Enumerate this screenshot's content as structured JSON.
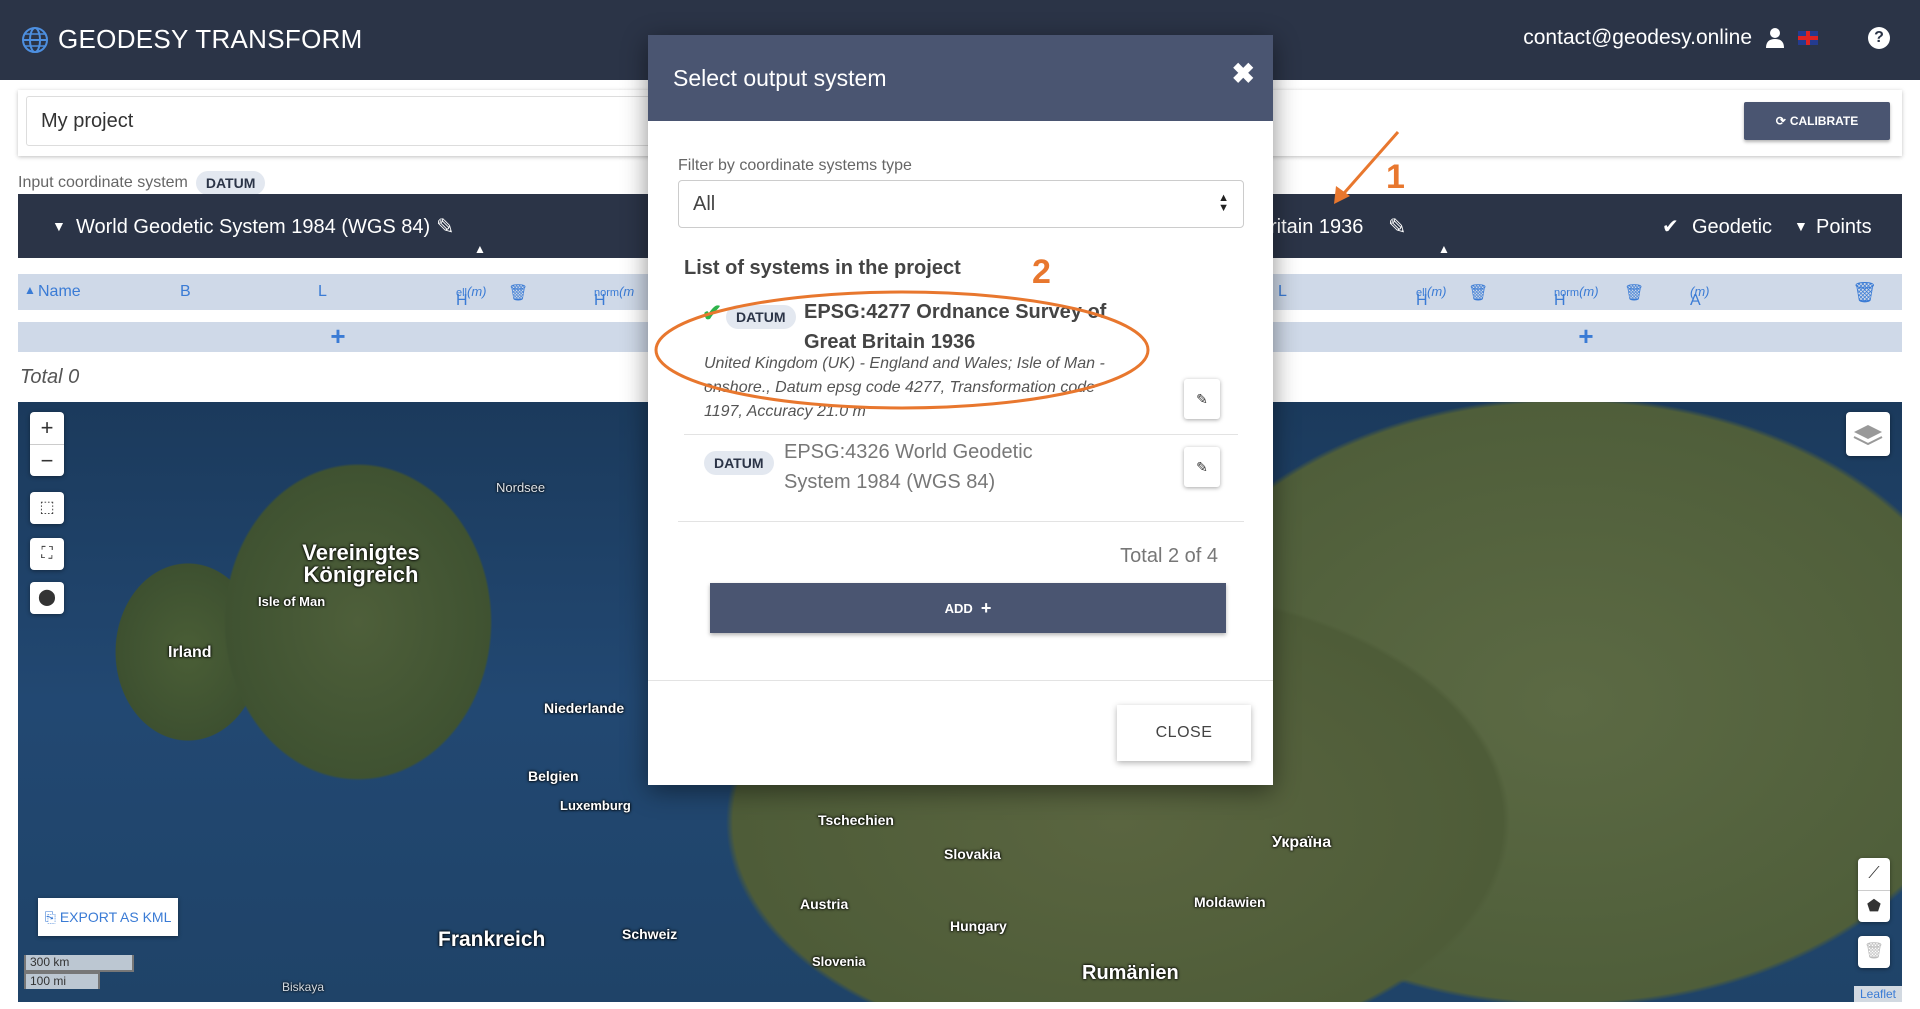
{
  "app": {
    "brand": "GEODESY TRANSFORM",
    "user_email": "contact@geodesy.online"
  },
  "project": {
    "name_value": "My project",
    "calibrate_label": "CALIBRATE"
  },
  "input_system": {
    "label": "Input coordinate system",
    "badge": "DATUM",
    "name": "World Geodetic System 1984 (WGS 84)",
    "columns": [
      "Name",
      "B",
      "L",
      "H",
      "ell",
      "(m)",
      "H",
      "norm",
      "(m"
    ]
  },
  "output_system": {
    "name_partial": "ritain 1936",
    "geodetic_label": "Geodetic",
    "points_label": "Points",
    "columns": [
      "L",
      "H",
      "ell",
      "(m)",
      "H",
      "norm",
      "(m)",
      "A",
      "(m)"
    ]
  },
  "table": {
    "add_symbol": "+",
    "total": "Total 0"
  },
  "map": {
    "zoom_in": "+",
    "zoom_out": "−",
    "export_label": "EXPORT AS KML",
    "scale_km": "300 km",
    "scale_mi": "100 mi",
    "attribution": "Leaflet",
    "labels": {
      "nordsee": "Nordsee",
      "uk": "Vereinigtes Königreich",
      "isle_of_man": "Isle of Man",
      "irland": "Irland",
      "niederlande": "Niederlande",
      "belgien": "Belgien",
      "luxemburg": "Luxemburg",
      "tschechien": "Tschechien",
      "slovakia": "Slovakia",
      "austria": "Austria",
      "hungary": "Hungary",
      "schweiz": "Schweiz",
      "frankreich": "Frankreich",
      "slovenia": "Slovenia",
      "rumaenien": "Rumänien",
      "moldawien": "Moldawien",
      "biskaya": "Biskaya",
      "ukraine_label": "Україна"
    }
  },
  "modal": {
    "title": "Select output system",
    "filter_label": "Filter by coordinate systems type",
    "filter_value": "All",
    "list_title": "List of systems in the project",
    "systems": [
      {
        "badge": "DATUM",
        "name": "EPSG:4277 Ordnance Survey of Great Britain 1936",
        "description": "United Kingdom (UK) - England and Wales; Isle of Man - onshore., Datum epsg code 4277, Transformation code 1197, Accuracy 21.0 m",
        "selected": true
      },
      {
        "badge": "DATUM",
        "name": "EPSG:4326 World Geodetic System 1984 (WGS 84)",
        "selected": false
      }
    ],
    "total": "Total 2 of 4",
    "add_label": "ADD",
    "close_label": "CLOSE"
  },
  "annotations": {
    "one": "1",
    "two": "2",
    "color": "#e8772e"
  },
  "colors": {
    "navbar": "#2b3447",
    "modal_header": "#4a5571",
    "accent_blue": "#3a7bd5",
    "check_green": "#2db34a"
  }
}
